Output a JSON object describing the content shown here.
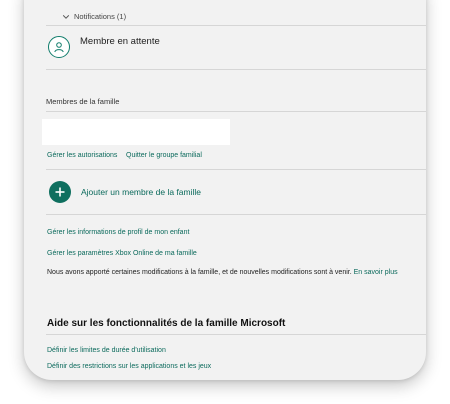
{
  "notifications": {
    "header": "Notifications (1)",
    "item_label": "Membre en attente"
  },
  "family": {
    "section_label": "Membres de la famille",
    "actions": [
      "Gérer les autorisations",
      "Quitter le groupe familial"
    ],
    "add_member": "Ajouter un membre de la famille"
  },
  "links": {
    "child_profile": "Gérer les informations de profil de mon enfant",
    "xbox_settings": "Gérer les paramètres Xbox Online de ma famille"
  },
  "notice": {
    "text": "Nous avons apporté certaines modifications à la famille, et de nouvelles modifications sont à venir.",
    "link": "En savoir plus"
  },
  "help": {
    "title": "Aide sur les fonctionnalités de la famille Microsoft",
    "links": [
      "Définir les limites de durée d'utilisation",
      "Définir des restrictions sur les applications et les jeux"
    ]
  },
  "colors": {
    "accent": "#0f6f5f",
    "link": "#0b6a5c",
    "panel_bg": "#f2f2f2"
  }
}
